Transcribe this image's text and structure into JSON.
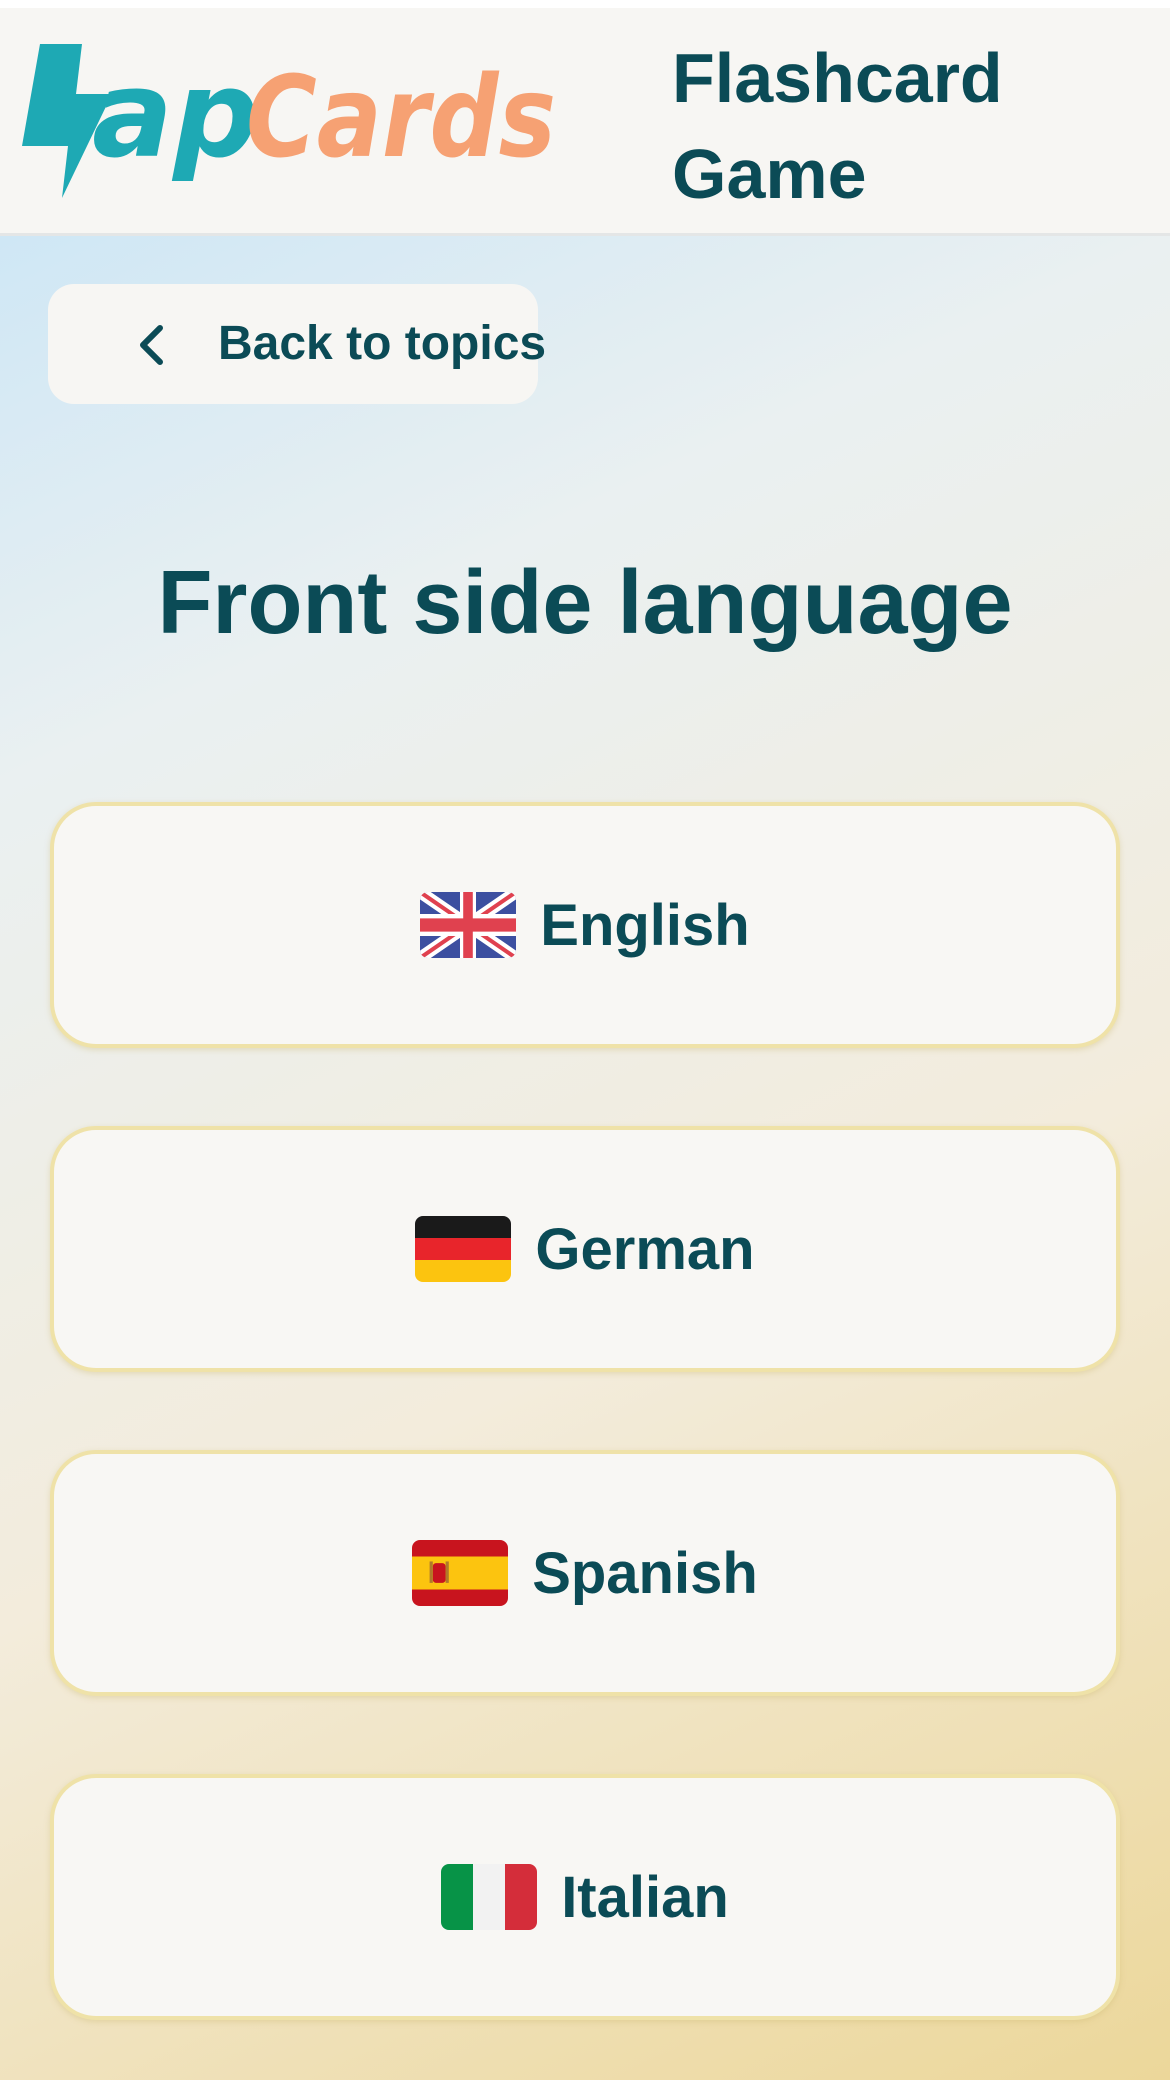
{
  "header": {
    "logo": {
      "text": "ZapCards",
      "primary_color": "#1ea9b4",
      "secondary_color": "#f6a173"
    },
    "title": "Flashcard Game"
  },
  "back_button": {
    "label": "Back to topics",
    "icon": "chevron-left-icon"
  },
  "heading": "Front side language",
  "languages": [
    {
      "label": "English",
      "flag": "uk-flag-icon"
    },
    {
      "label": "German",
      "flag": "germany-flag-icon"
    },
    {
      "label": "Spanish",
      "flag": "spain-flag-icon"
    },
    {
      "label": "Italian",
      "flag": "italy-flag-icon"
    }
  ],
  "colors": {
    "text": "#0b4b56",
    "card_border": "#efe2a8",
    "card_bg": "#f8f7f4"
  }
}
